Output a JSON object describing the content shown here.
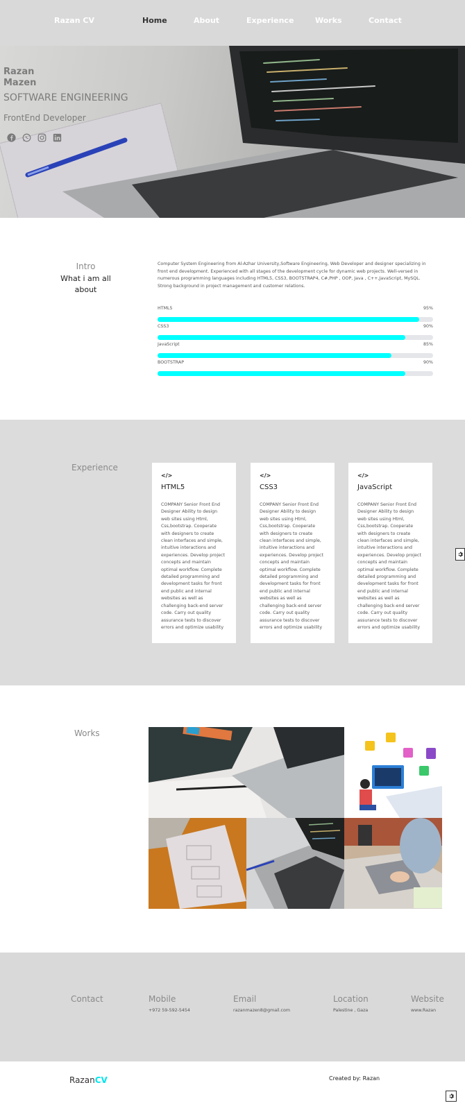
{
  "nav": {
    "brand": "Razan CV",
    "links": [
      "Home",
      "About",
      "Experience",
      "Works",
      "Contact"
    ]
  },
  "hero": {
    "first_name": "Razan",
    "last_name": "Mazen",
    "role": "SOFTWARE ENGINEERING",
    "subtitle": "FrontEnd Developer",
    "social_icons": [
      "facebook-icon",
      "whatsapp-icon",
      "instagram-icon",
      "linkedin-icon"
    ]
  },
  "intro": {
    "heading": "Intro",
    "subheading": "What i am all about",
    "description": "Computer System Engineering from Al-Azhar University,Software Engineering, Web Developer and designer specializing in front end development. Experienced with all stages of the development cycle for dynamic web projects. Well-versed in numerous programming languages including HTML5, CSS3, BOOTSTRAP4, C#,PHP , OOP, Java , C++,JavaScript, MySQL. Strong background in project management and customer relations.",
    "skills": [
      {
        "label": "HTML5",
        "percent_text": "95%",
        "value": 95
      },
      {
        "label": "CSS3",
        "percent_text": "90%",
        "value": 90
      },
      {
        "label": "JavaScript",
        "percent_text": "85%",
        "value": 85
      },
      {
        "label": "BOOTSTRAP",
        "percent_text": "90%",
        "value": 90
      }
    ]
  },
  "experience": {
    "heading": "Experience",
    "cards": [
      {
        "icon": "</>",
        "title": "HTML5",
        "text": "COMPANY Senior Front End Designer Ability to design web sites using Html, Css,bootstrap. Cooperate with designers to create clean interfaces and simple, intuitive interactions and experiences. Develop project concepts and maintain optimal workflow. Complete detailed programming and development tasks for front end public and internal websites as well as challenging back-end server code. Carry out quality assurance tests to discover errors and optimize usability"
      },
      {
        "icon": "</>",
        "title": "CSS3",
        "text": "COMPANY Senior Front End Designer Ability to design web sites using Html, Css,bootstrap. Cooperate with designers to create clean interfaces and simple, intuitive interactions and experiences. Develop project concepts and maintain optimal workflow. Complete detailed programming and development tasks for front end public and internal websites as well as challenging back-end server code. Carry out quality assurance tests to discover errors and optimize usability"
      },
      {
        "icon": "</>",
        "title": "JavaScript",
        "text": "COMPANY Senior Front End Designer Ability to design web sites using Html, Css,bootstrap. Cooperate with designers to create clean interfaces and simple, intuitive interactions and experiences. Develop project concepts and maintain optimal workflow. Complete detailed programming and development tasks for front end public and internal websites as well as challenging back-end server code. Carry out quality assurance tests to discover errors and optimize usability"
      }
    ]
  },
  "works": {
    "heading": "Works"
  },
  "contact": {
    "heading": "Contact",
    "items": [
      {
        "label": "Mobile",
        "value": "+972 59-592-5454"
      },
      {
        "label": "Email",
        "value": "razanmazen8@gmail.com"
      },
      {
        "label": "Location",
        "value": "Palestine , Gaza"
      },
      {
        "label": "Website",
        "value": "www.Razan"
      }
    ]
  },
  "footer": {
    "logo_main": "Razan",
    "logo_accent": "CV",
    "created": "Created by: Razan"
  },
  "colors": {
    "accent": "#00ffff",
    "nav_bg": "#d9d9d9",
    "section_bg": "#dcdcdc"
  }
}
